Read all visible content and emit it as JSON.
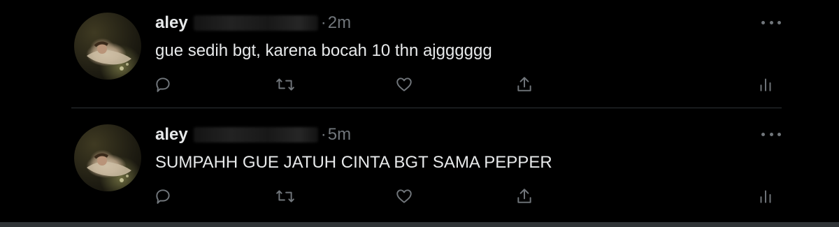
{
  "tweets": [
    {
      "author_name": "aley",
      "separator": "·",
      "time": "2m",
      "text": "gue sedih bgt, karena bocah 10 thn ajgggggg"
    },
    {
      "author_name": "aley",
      "separator": "·",
      "time": "5m",
      "text": "SUMPAHH GUE JATUH CINTA BGT SAMA PEPPER"
    }
  ],
  "icons": {
    "reply": "reply-icon",
    "retweet": "retweet-icon",
    "like": "like-icon",
    "share": "share-icon",
    "analytics": "analytics-icon",
    "more": "more-icon"
  },
  "colors": {
    "background": "#000000",
    "text": "#e7e9ea",
    "muted": "#71767b",
    "divider": "#2f3336"
  }
}
